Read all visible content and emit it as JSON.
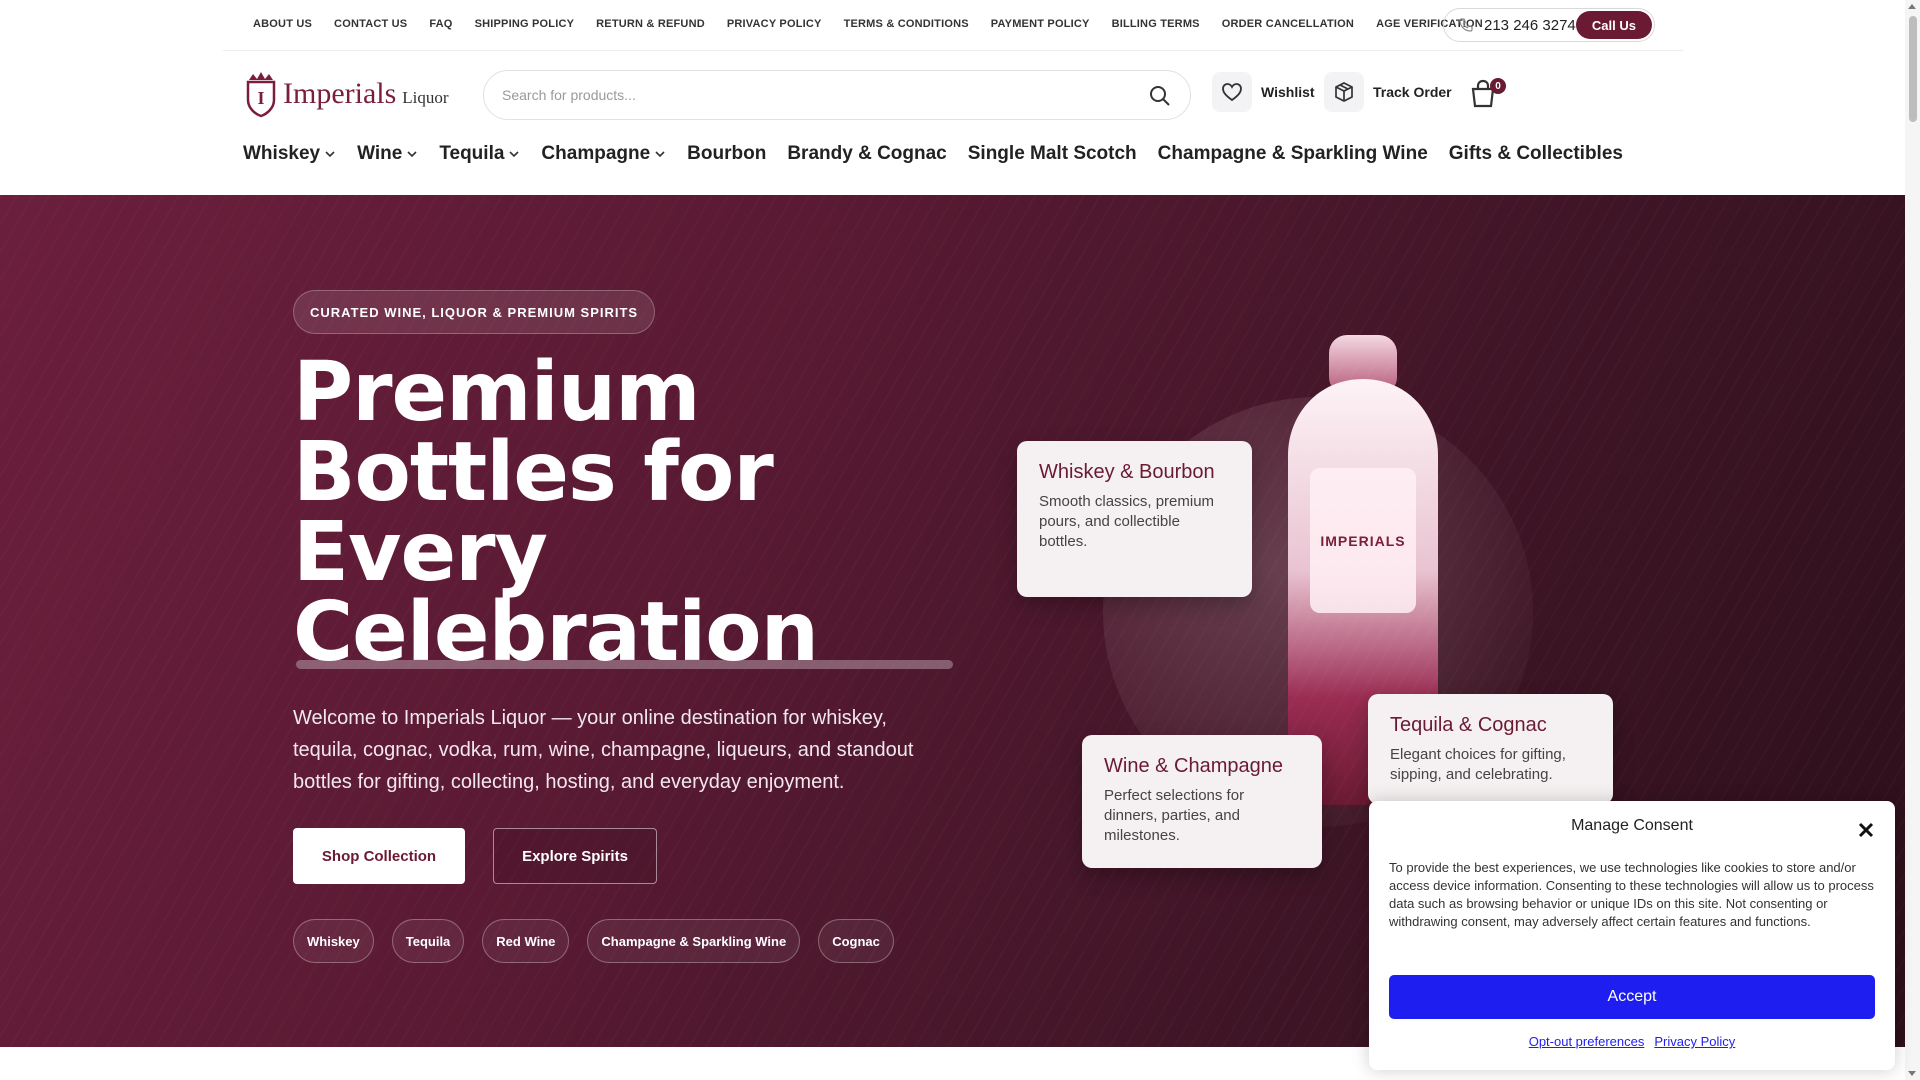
{
  "topbar": {
    "links": [
      "ABOUT US",
      "CONTACT US",
      "FAQ",
      "SHIPPING POLICY",
      "RETURN & REFUND",
      "PRIVACY POLICY",
      "TERMS & CONDITIONS",
      "PAYMENT POLICY",
      "BILLING TERMS",
      "ORDER CANCELLATION",
      "AGE VERIFICATION"
    ],
    "phone": "213 246 3274",
    "call_label": "Call Us"
  },
  "header": {
    "logo_name": "Imperials",
    "logo_sub": "Liquor",
    "search_placeholder": "Search for products...",
    "wishlist_label": "Wishlist",
    "track_label": "Track Order",
    "cart_count": "0"
  },
  "nav": {
    "items": [
      {
        "label": "Whiskey",
        "dropdown": true
      },
      {
        "label": "Wine",
        "dropdown": true
      },
      {
        "label": "Tequila",
        "dropdown": true
      },
      {
        "label": "Champagne",
        "dropdown": true
      },
      {
        "label": "Bourbon",
        "dropdown": false
      },
      {
        "label": "Brandy & Cognac",
        "dropdown": false
      },
      {
        "label": "Single Malt Scotch",
        "dropdown": false
      },
      {
        "label": "Champagne & Sparkling Wine",
        "dropdown": false
      },
      {
        "label": "Gifts & Collectibles",
        "dropdown": false
      }
    ]
  },
  "hero": {
    "tag": "CURATED WINE, LIQUOR & PREMIUM SPIRITS",
    "title_lines": [
      "Premium",
      "Bottles for",
      "Every",
      "Celebration"
    ],
    "description": "Welcome to Imperials Liquor — your online destination for whiskey, tequila, cognac, vodka, rum, wine, champagne, liqueurs, and standout bottles for gifting, collecting, hosting, and everyday enjoyment.",
    "primary_button": "Shop Collection",
    "secondary_button": "Explore Spirits",
    "chips": [
      "Whiskey",
      "Tequila",
      "Red Wine",
      "Champagne & Sparkling Wine",
      "Cognac"
    ],
    "bottle_label": "IMPERIALS",
    "cards": [
      {
        "title": "Whiskey & Bourbon",
        "text": "Smooth classics, premium pours, and collectible bottles."
      },
      {
        "title": "Wine & Champagne",
        "text": "Perfect selections for dinners, parties, and milestones."
      },
      {
        "title": "Tequila & Cognac",
        "text": "Elegant choices for gifting, sipping, and celebrating."
      }
    ]
  },
  "consent": {
    "title": "Manage Consent",
    "body": "To provide the best experiences, we use technologies like cookies to store and/or access device information. Consenting to these technologies will allow us to process data such as browsing behavior or unique IDs on this site. Not consenting or withdrawing consent, may adversely affect certain features and functions.",
    "accept_label": "Accept",
    "optout_label": "Opt-out preferences",
    "privacy_label": "Privacy Policy"
  },
  "colors": {
    "brand": "#6a1b33",
    "accept": "#1e1ef0"
  },
  "icons": [
    "phone-icon",
    "search-icon",
    "heart-icon",
    "box-icon",
    "cart-icon",
    "chevron-down-icon",
    "close-icon",
    "crest-icon"
  ]
}
